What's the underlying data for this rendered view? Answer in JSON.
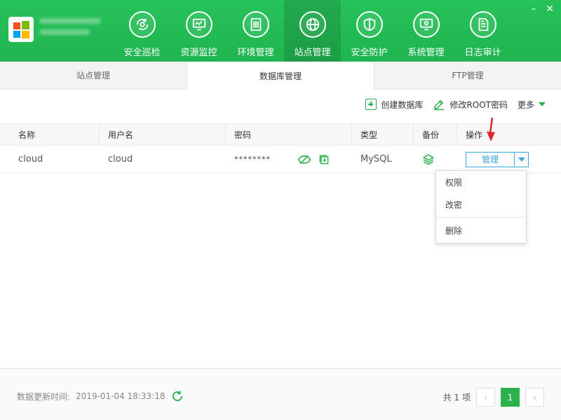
{
  "window": {
    "minimize": "–",
    "close": "✕"
  },
  "nav": [
    {
      "label": "安全巡检",
      "icon": "scan-icon"
    },
    {
      "label": "资源监控",
      "icon": "monitor-chart-icon"
    },
    {
      "label": "环境管理",
      "icon": "server-icon"
    },
    {
      "label": "站点管理",
      "icon": "globe-icon",
      "active": true
    },
    {
      "label": "安全防护",
      "icon": "shield-icon"
    },
    {
      "label": "系统管理",
      "icon": "settings-monitor-icon"
    },
    {
      "label": "日志审计",
      "icon": "document-icon"
    }
  ],
  "tabs": [
    {
      "label": "站点管理"
    },
    {
      "label": "数据库管理",
      "active": true
    },
    {
      "label": "FTP管理"
    }
  ],
  "toolbar": {
    "create_db": "创建数据库",
    "edit_root_pwd": "修改ROOT密码",
    "more": "更多"
  },
  "table": {
    "headers": [
      "名称",
      "用户名",
      "密码",
      "类型",
      "备份",
      "操作"
    ],
    "rows": [
      {
        "name": "cloud",
        "user": "cloud",
        "password": "********",
        "type": "MySQL",
        "action": "管理"
      }
    ]
  },
  "menu": {
    "items": [
      "权限",
      "改密",
      "删除"
    ]
  },
  "footer": {
    "updated_label": "数据更新时间:",
    "updated_time": "2019-01-04 18:33:18",
    "total": "共 1 项",
    "current_page": "1"
  },
  "colors": {
    "brand_green": "#1fb44f",
    "accent_blue": "#3aa8e0",
    "arrow_red": "#e02b2b"
  }
}
